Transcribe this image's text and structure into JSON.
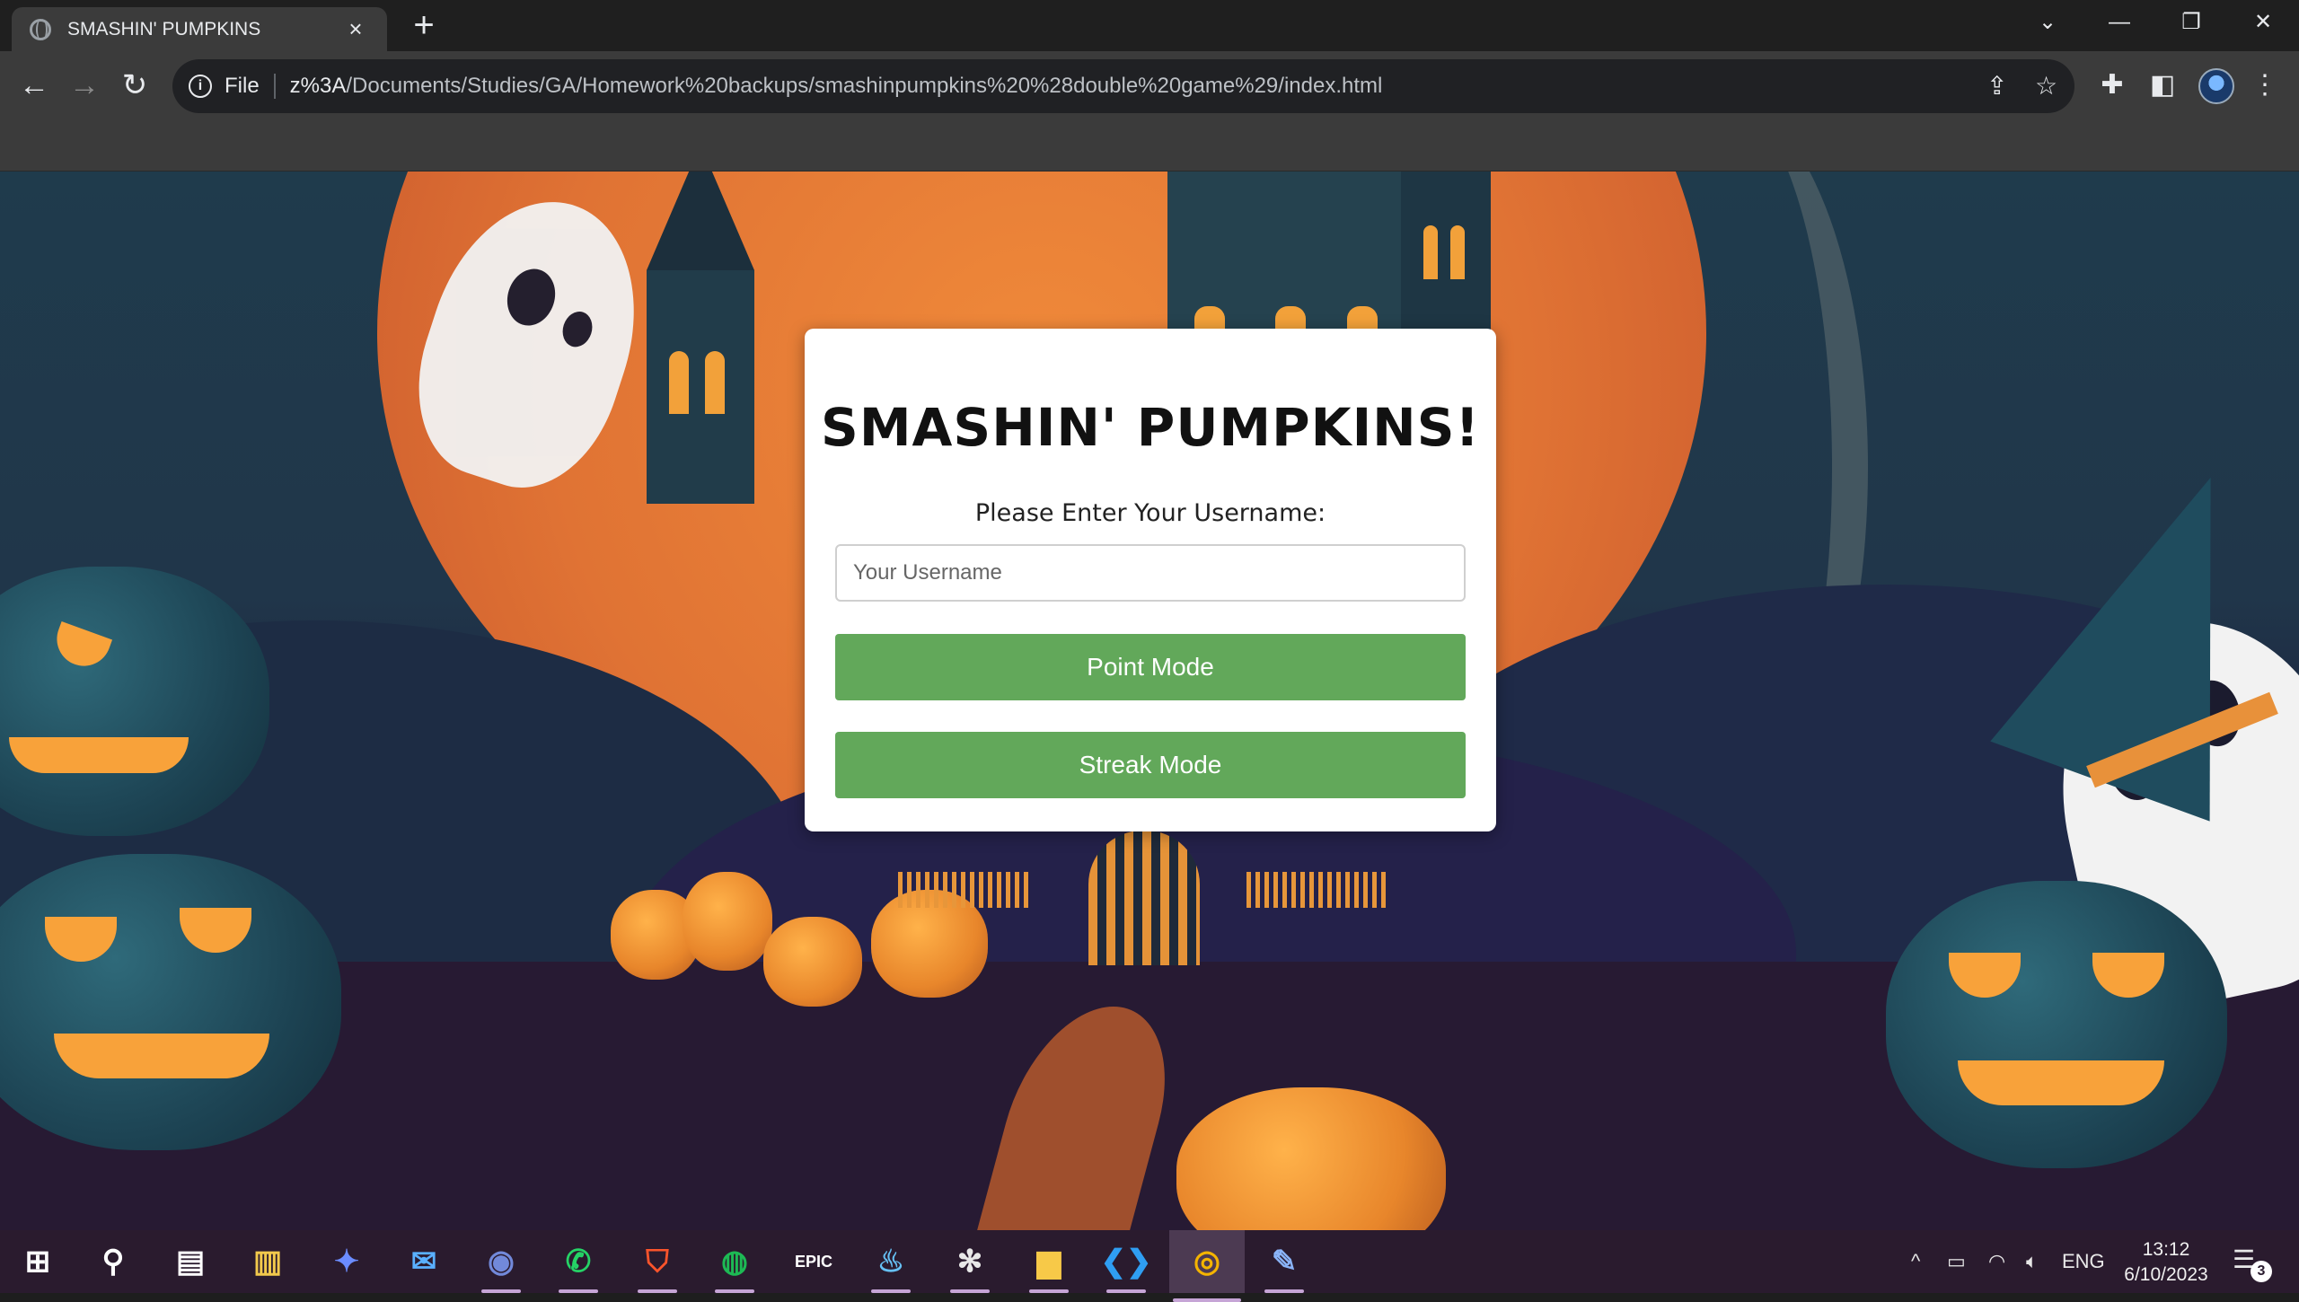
{
  "browser": {
    "tab_title": "SMASHIN' PUMPKINS",
    "tab_close": "×",
    "new_tab": "+",
    "window_controls": [
      "⌄",
      "—",
      "❐",
      "✕"
    ],
    "nav": {
      "back": "←",
      "forward": "→",
      "reload": "↻"
    },
    "address": {
      "info_glyph": "i",
      "scheme_label": "File",
      "url_host": "z%3A",
      "url_path": "/Documents/Studies/GA/Homework%20backups/smashinpumpkins%20%28double%20game%29/index.html"
    },
    "toolbar_icons": {
      "share": "⇪",
      "star": "☆",
      "extensions": "✚",
      "sidepanel": "◧",
      "menu": "⋮"
    }
  },
  "card": {
    "title": "SMASHIN' PUMPKINS!",
    "prompt": "Please Enter Your Username:",
    "username_placeholder": "Your Username",
    "username_value": "",
    "point_mode_label": "Point Mode",
    "streak_mode_label": "Streak Mode",
    "button_color": "#62a85a"
  },
  "taskbar": {
    "apps": [
      {
        "name": "start-icon",
        "glyph": "⊞",
        "color": "#ffffff"
      },
      {
        "name": "search-icon",
        "glyph": "⚲",
        "color": "#ffffff"
      },
      {
        "name": "task-view-icon",
        "glyph": "▤",
        "color": "#ffffff"
      },
      {
        "name": "store-icon",
        "glyph": "▥",
        "color": "#f2c94c"
      },
      {
        "name": "messenger-icon",
        "glyph": "✦",
        "color": "#6b8cff"
      },
      {
        "name": "mail-icon",
        "glyph": "✉",
        "color": "#5ab0ff"
      },
      {
        "name": "discord-icon",
        "glyph": "◉",
        "color": "#7289da"
      },
      {
        "name": "whatsapp-icon",
        "glyph": "✆",
        "color": "#25d366"
      },
      {
        "name": "brave-icon",
        "glyph": "⛉",
        "color": "#fb542b"
      },
      {
        "name": "spotify-icon",
        "glyph": "◍",
        "color": "#1db954"
      },
      {
        "name": "epic-games-icon",
        "glyph": "EPIC",
        "color": "#ffffff"
      },
      {
        "name": "steam-icon",
        "glyph": "♨",
        "color": "#66c0f4"
      },
      {
        "name": "slack-icon",
        "glyph": "✻",
        "color": "#e8e8e8"
      },
      {
        "name": "file-explorer-icon",
        "glyph": "▆",
        "color": "#f7c948"
      },
      {
        "name": "vscode-icon",
        "glyph": "❮❯",
        "color": "#2f9ef2"
      },
      {
        "name": "chrome-icon",
        "glyph": "◎",
        "color": "#f4b400"
      },
      {
        "name": "paint-icon",
        "glyph": "✎",
        "color": "#8ab4f8"
      }
    ],
    "tray": {
      "chevron": "^",
      "language": "ENG"
    },
    "time": "13:12",
    "date": "6/10/2023",
    "notification_count": "3"
  }
}
